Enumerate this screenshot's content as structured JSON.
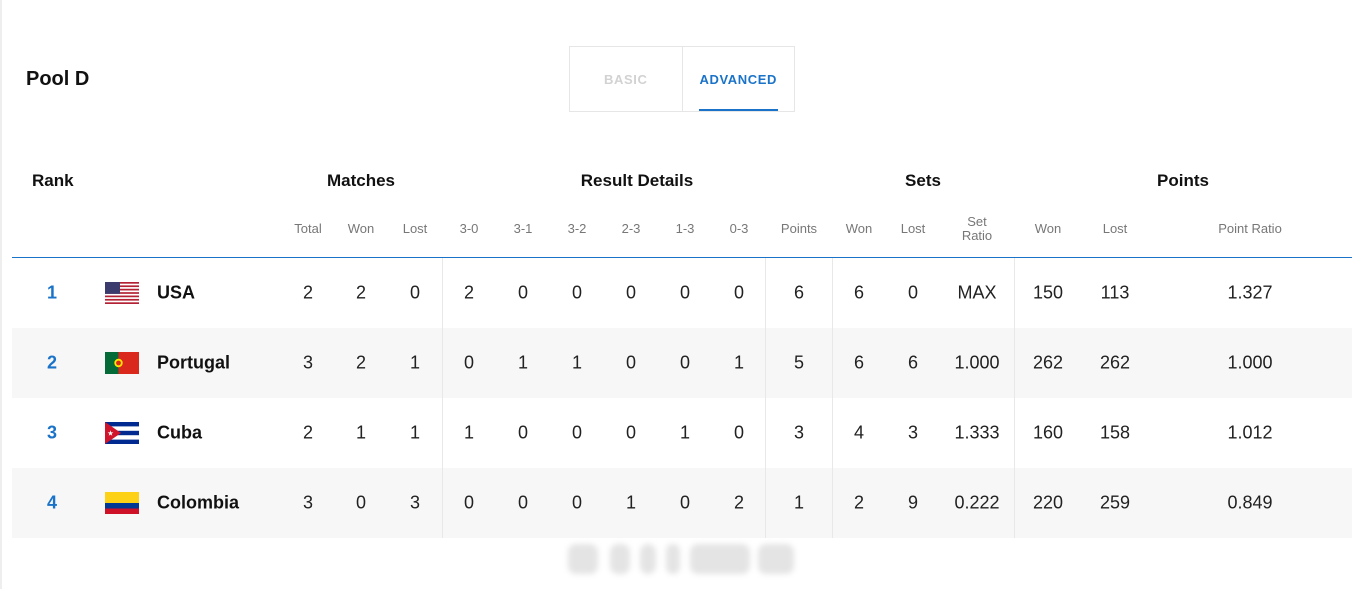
{
  "pool": {
    "title": "Pool D"
  },
  "tabs": [
    {
      "label": "BASIC",
      "active": false
    },
    {
      "label": "ADVANCED",
      "active": true
    }
  ],
  "groups": {
    "rank": "Rank",
    "matches": "Matches",
    "result_details": "Result Details",
    "sets": "Sets",
    "points": "Points"
  },
  "columns": [
    "Total",
    "Won",
    "Lost",
    "3-0",
    "3-1",
    "3-2",
    "2-3",
    "1-3",
    "0-3",
    "Points",
    "Won",
    "Lost",
    "Set Ratio",
    "Won",
    "Lost",
    "Point Ratio"
  ],
  "rows": [
    {
      "rank": "1",
      "team": "USA",
      "flag": "usa-flag-icon",
      "values": [
        "2",
        "2",
        "0",
        "2",
        "0",
        "0",
        "0",
        "0",
        "0",
        "6",
        "6",
        "0",
        "MAX",
        "150",
        "113",
        "1.327"
      ]
    },
    {
      "rank": "2",
      "team": "Portugal",
      "flag": "portugal-flag-icon",
      "values": [
        "3",
        "2",
        "1",
        "0",
        "1",
        "1",
        "0",
        "0",
        "1",
        "5",
        "6",
        "6",
        "1.000",
        "262",
        "262",
        "1.000"
      ]
    },
    {
      "rank": "3",
      "team": "Cuba",
      "flag": "cuba-flag-icon",
      "values": [
        "2",
        "1",
        "1",
        "1",
        "0",
        "0",
        "0",
        "1",
        "0",
        "3",
        "4",
        "3",
        "1.333",
        "160",
        "158",
        "1.012"
      ]
    },
    {
      "rank": "4",
      "team": "Colombia",
      "flag": "colombia-flag-icon",
      "values": [
        "3",
        "0",
        "3",
        "0",
        "0",
        "0",
        "1",
        "0",
        "2",
        "1",
        "2",
        "9",
        "0.222",
        "220",
        "259",
        "0.849"
      ]
    }
  ],
  "colors": {
    "accent": "#1a73c8",
    "row_shade": "#f7f7f7"
  }
}
